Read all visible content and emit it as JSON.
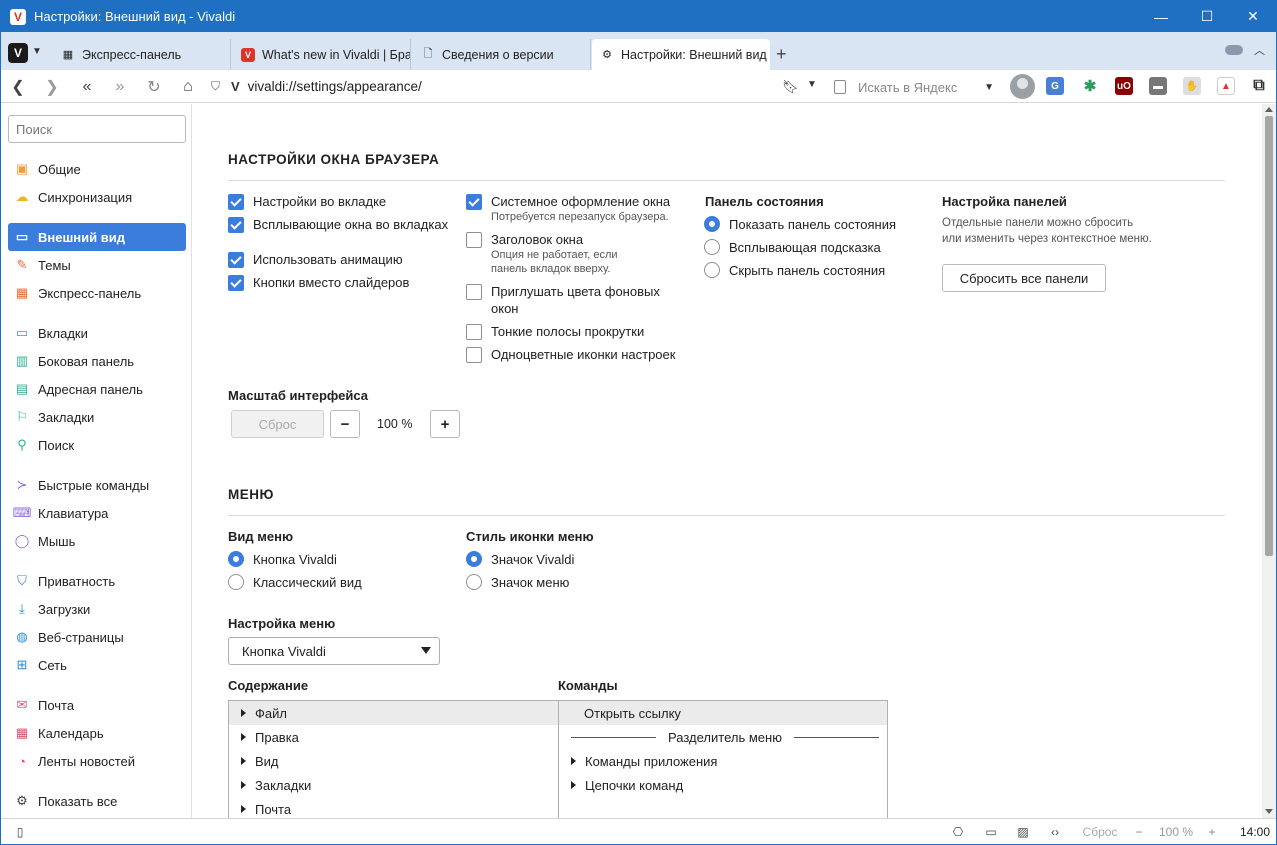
{
  "window": {
    "title": "Настройки: Внешний вид - Vivaldi",
    "controls": {
      "minimize": "—",
      "maximize": "☐",
      "close": "✕"
    }
  },
  "colors": {
    "titlebar": "#1f6fc2",
    "accent": "#3b7ddd",
    "tabbar": "#d9e5f3"
  },
  "tabs": [
    {
      "label": "Экспресс-панель",
      "icon": "speed-dial-icon"
    },
    {
      "label": "What's new in Vivaldi | Бра",
      "icon": "vivaldi-icon"
    },
    {
      "label": "Сведения о версии",
      "icon": "page-icon"
    },
    {
      "label": "Настройки: Внешний вид",
      "icon": "gear-icon",
      "active": true
    }
  ],
  "address": {
    "url": "vivaldi://settings/appearance/",
    "search_placeholder": "Искать в Яндекс"
  },
  "sidebar": {
    "search_placeholder": "Поиск",
    "items": [
      {
        "label": "Общие",
        "icon": "general-icon",
        "color": "#f29c38"
      },
      {
        "label": "Синхронизация",
        "icon": "cloud-icon",
        "color": "#f0b429"
      },
      {
        "label": "Внешний вид",
        "icon": "appearance-icon",
        "active": true
      },
      {
        "label": "Темы",
        "icon": "brush-icon",
        "color": "#f06a35"
      },
      {
        "label": "Экспресс-панель",
        "icon": "speed-dial-icon",
        "color": "#f06a35"
      },
      {
        "label": "Вкладки",
        "icon": "tabs-icon",
        "color": "#2fae8f"
      },
      {
        "label": "Боковая панель",
        "icon": "panel-icon",
        "color": "#2fae8f"
      },
      {
        "label": "Адресная панель",
        "icon": "address-bar-icon",
        "color": "#2fae8f"
      },
      {
        "label": "Закладки",
        "icon": "bookmark-icon",
        "color": "#2fae8f"
      },
      {
        "label": "Поиск",
        "icon": "search-icon",
        "color": "#2fae8f"
      },
      {
        "label": "Быстрые команды",
        "icon": "quick-commands-icon",
        "color": "#8e6bd8"
      },
      {
        "label": "Клавиатура",
        "icon": "keyboard-icon",
        "color": "#8e6bd8"
      },
      {
        "label": "Мышь",
        "icon": "mouse-icon",
        "color": "#8e6bd8"
      },
      {
        "label": "Приватность",
        "icon": "shield-icon",
        "color": "#2a8ad8"
      },
      {
        "label": "Загрузки",
        "icon": "download-icon",
        "color": "#2a8ad8"
      },
      {
        "label": "Веб-страницы",
        "icon": "globe-icon",
        "color": "#2a8ad8"
      },
      {
        "label": "Сеть",
        "icon": "network-icon",
        "color": "#2a8ad8"
      },
      {
        "label": "Почта",
        "icon": "mail-icon",
        "color": "#e0506a"
      },
      {
        "label": "Календарь",
        "icon": "calendar-icon",
        "color": "#e0506a"
      },
      {
        "label": "Ленты новостей",
        "icon": "feed-icon",
        "color": "#e0506a"
      },
      {
        "label": "Показать все",
        "icon": "gear-icon",
        "color": "#444444"
      }
    ]
  },
  "browser_window": {
    "heading": "НАСТРОЙКИ ОКНА БРАУЗЕРА",
    "col1": [
      {
        "label": "Настройки во вкладке",
        "checked": true
      },
      {
        "label": "Всплывающие окна во вкладках",
        "checked": true
      },
      {
        "label": "Использовать анимацию",
        "checked": true
      },
      {
        "label": "Кнопки вместо слайдеров",
        "checked": true
      }
    ],
    "col2": [
      {
        "label": "Системное оформление окна",
        "hint": "Потребуется перезапуск браузера.",
        "checked": true
      },
      {
        "label": "Заголовок окна",
        "hint1": "Опция не работает, если",
        "hint2": "панель вкладок вверху.",
        "checked": false
      },
      {
        "label1": "Приглушать цвета фоновых",
        "label2": "окон",
        "checked": false
      },
      {
        "label": "Тонкие полосы прокрутки",
        "checked": false
      },
      {
        "label": "Одноцветные иконки настроек",
        "checked": false
      }
    ],
    "status_panel": {
      "title": "Панель состояния",
      "options": [
        "Показать панель состояния",
        "Всплывающая подсказка",
        "Скрыть панель состояния"
      ],
      "selected": 0
    },
    "panels": {
      "title": "Настройка панелей",
      "desc1": "Отдельные панели можно сбросить",
      "desc2": "или изменить через контекстное меню.",
      "reset_button": "Сбросить все панели"
    },
    "scale": {
      "title": "Масштаб интерфейса",
      "reset": "Сброс",
      "minus": "−",
      "value": "100 %",
      "plus": "+"
    }
  },
  "menu": {
    "heading": "МЕНЮ",
    "view": {
      "title": "Вид меню",
      "options": [
        "Кнопка Vivaldi",
        "Классический вид"
      ],
      "selected": 0
    },
    "icon_style": {
      "title": "Стиль иконки меню",
      "options": [
        "Значок Vivaldi",
        "Значок меню"
      ],
      "selected": 0
    },
    "customize": {
      "title": "Настройка меню",
      "selected": "Кнопка Vivaldi"
    },
    "contents": {
      "title": "Содержание",
      "items": [
        "Файл",
        "Правка",
        "Вид",
        "Закладки",
        "Почта"
      ]
    },
    "commands": {
      "title": "Команды",
      "open_link": "Открыть ссылку",
      "separator": "Разделитель меню",
      "items": [
        "Команды приложения",
        "Цепочки команд"
      ]
    }
  },
  "statusbar": {
    "reset": "Сброс",
    "zoom": "100 %",
    "minus": "−",
    "plus": "+",
    "time": "14:00"
  }
}
